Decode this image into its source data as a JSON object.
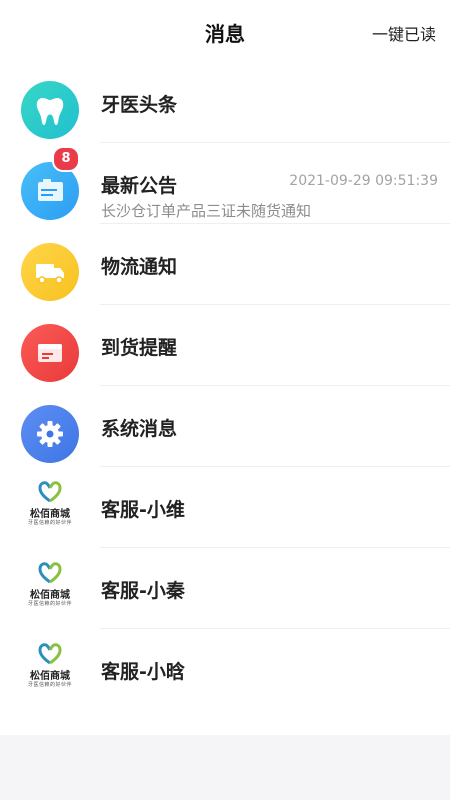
{
  "header": {
    "title": "消息",
    "read_all_label": "一键已读"
  },
  "colors": {
    "tooth_gradient": [
      "#37d7c5",
      "#21bfd0"
    ],
    "announcement_gradient": [
      "#49bff8",
      "#2b9df3"
    ],
    "logistics_gradient": [
      "#ffd54a",
      "#f7c220"
    ],
    "arrival_gradient": [
      "#fb5b58",
      "#e83a3a"
    ],
    "system_gradient": [
      "#5d8ff2",
      "#3f74e4"
    ],
    "badge": "#ea3b4a",
    "brand_green": "#8bbf3f",
    "brand_blue": "#2a8fbf"
  },
  "messages": [
    {
      "name": "牙医头条",
      "icon": "tooth-icon"
    },
    {
      "name": "最新公告",
      "icon": "announcement-icon",
      "badge": "8",
      "time": "2021-09-29 09:51:39",
      "preview": "长沙仓订单产品三证未随货通知"
    },
    {
      "name": "物流通知",
      "icon": "truck-icon"
    },
    {
      "name": "到货提醒",
      "icon": "arrival-icon"
    },
    {
      "name": "系统消息",
      "icon": "gear-icon"
    },
    {
      "name": "客服-小维",
      "icon": "store-logo"
    },
    {
      "name": "客服-小秦",
      "icon": "store-logo"
    },
    {
      "name": "客服-小晗",
      "icon": "store-logo"
    }
  ],
  "brand": {
    "name": "松佰商城",
    "tagline": "牙医信赖的好伙伴"
  }
}
